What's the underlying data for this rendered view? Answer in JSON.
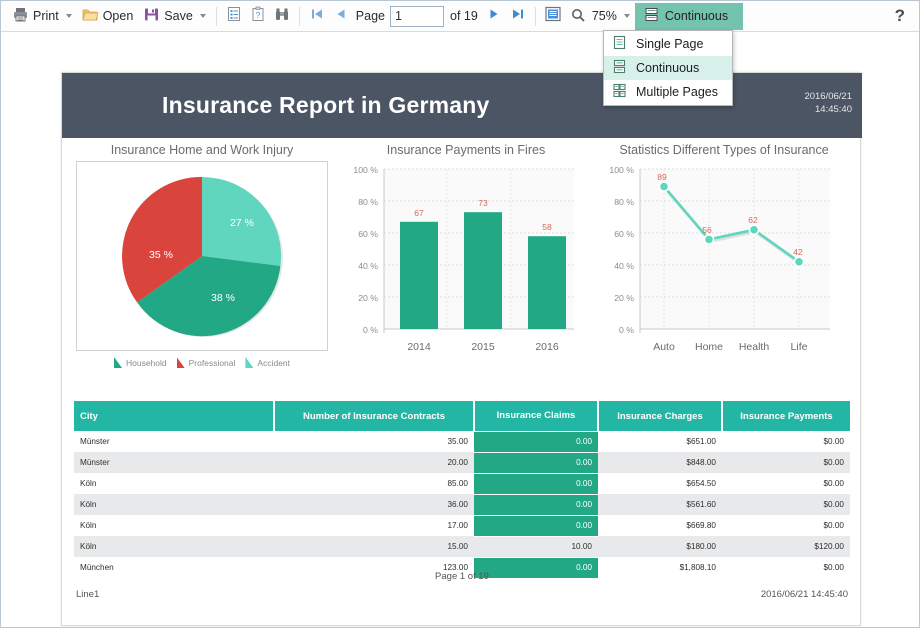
{
  "toolbar": {
    "print_label": "Print",
    "open_label": "Open",
    "save_label": "Save",
    "page_label": "Page",
    "page_value": "1",
    "of_label": "of 19",
    "zoom_label": "75%",
    "mode_label": "Continuous",
    "help_label": "?",
    "icons": {
      "print": "printer-icon",
      "open": "folder-open-icon",
      "save": "floppy-disk-icon",
      "bookmarks": "document-outline-icon",
      "parameters": "clipboard-question-icon",
      "find": "binoculars-icon",
      "first": "first-page-icon",
      "prev": "previous-page-icon",
      "next": "next-page-icon",
      "last": "last-page-icon",
      "view": "page-view-icon",
      "zoom": "magnifier-icon",
      "mode": "continuous-pages-icon"
    }
  },
  "dropdown": {
    "items": [
      {
        "label": "Single Page",
        "icon": "single-page-icon",
        "selected": false
      },
      {
        "label": "Continuous",
        "icon": "continuous-pages-icon",
        "selected": true
      },
      {
        "label": "Multiple Pages",
        "icon": "multiple-pages-icon",
        "selected": false
      }
    ]
  },
  "report": {
    "title": "Insurance Report in Germany",
    "stamp_date": "2016/06/21",
    "stamp_time": "14:45:40",
    "header_bg": "#4b5563"
  },
  "colors": {
    "teal": "#22a884",
    "light_teal": "#5fd6bd",
    "red": "#d9453c",
    "table_header": "#23b6a4",
    "value_label": "#d9675c"
  },
  "chart_data": [
    {
      "type": "pie",
      "title": "Insurance Home and Work Injury",
      "categories": [
        "Household",
        "Professional",
        "Accident"
      ],
      "values": [
        38,
        35,
        27
      ],
      "value_labels": [
        "38 %",
        "35 %",
        "27 %"
      ],
      "colors": [
        "#22a884",
        "#d9453c",
        "#5fd6bd"
      ],
      "legend": "bottom"
    },
    {
      "type": "bar",
      "title": "Insurance Payments in Fires",
      "categories": [
        "2014",
        "2015",
        "2016"
      ],
      "values": [
        67,
        73,
        58
      ],
      "xlabel": "",
      "ylabel": "",
      "ylim": [
        0,
        100
      ],
      "yticks": [
        "0 %",
        "20 %",
        "40 %",
        "60 %",
        "80 %",
        "100 %"
      ],
      "grid": true,
      "color": "#22a884"
    },
    {
      "type": "line",
      "title": "Statistics Different Types of Insurance",
      "categories": [
        "Auto",
        "Home",
        "Health",
        "Life"
      ],
      "values": [
        89,
        56,
        62,
        42
      ],
      "xlabel": "",
      "ylabel": "",
      "ylim": [
        0,
        100
      ],
      "yticks": [
        "0 %",
        "20 %",
        "40 %",
        "60 %",
        "80 %",
        "100 %"
      ],
      "grid": true,
      "color": "#5fd6bd"
    }
  ],
  "table": {
    "columns": [
      "City",
      "Number of Insurance Contracts",
      "Insurance Claims",
      "Insurance Charges",
      "Insurance Payments"
    ],
    "rows": [
      {
        "city": "Münster",
        "contracts": "35.00",
        "claims": "0.00",
        "claims_highlight": true,
        "charges": "$651.00",
        "payments": "$0.00"
      },
      {
        "city": "Münster",
        "contracts": "20.00",
        "claims": "0.00",
        "claims_highlight": true,
        "charges": "$848.00",
        "payments": "$0.00"
      },
      {
        "city": "Köln",
        "contracts": "85.00",
        "claims": "0.00",
        "claims_highlight": true,
        "charges": "$654.50",
        "payments": "$0.00"
      },
      {
        "city": "Köln",
        "contracts": "36.00",
        "claims": "0.00",
        "claims_highlight": true,
        "charges": "$561.60",
        "payments": "$0.00"
      },
      {
        "city": "Köln",
        "contracts": "17.00",
        "claims": "0.00",
        "claims_highlight": true,
        "charges": "$669.80",
        "payments": "$0.00"
      },
      {
        "city": "Köln",
        "contracts": "15.00",
        "claims": "10.00",
        "claims_highlight": false,
        "charges": "$180.00",
        "payments": "$120.00"
      },
      {
        "city": "München",
        "contracts": "123.00",
        "claims": "0.00",
        "claims_highlight": true,
        "charges": "$1,808.10",
        "payments": "$0.00"
      }
    ]
  },
  "footer": {
    "center": "Page 1 of 19",
    "left": "Line1",
    "right": "2016/06/21 14:45:40"
  }
}
